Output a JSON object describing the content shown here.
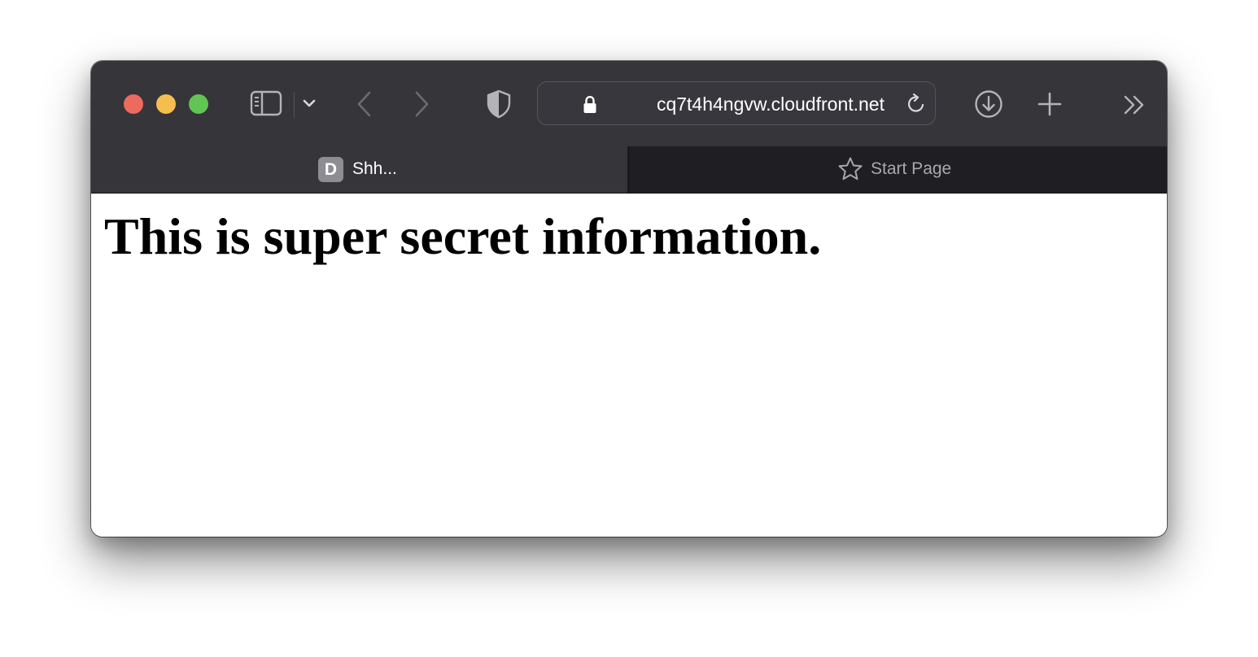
{
  "browser": {
    "window_controls": [
      "close",
      "minimize",
      "zoom"
    ],
    "toolbar": {
      "sidebar_icon": "sidebar-icon",
      "tab_overview_icon": "chevron-down-icon",
      "back_icon": "chevron-left-icon",
      "forward_icon": "chevron-right-icon",
      "privacy_icon": "shield-icon",
      "download_icon": "download-icon",
      "new_tab_icon": "plus-icon",
      "more_icon": "double-chevron-right-icon"
    },
    "address_bar": {
      "lock_icon": "lock-icon",
      "url": "cq7t4h4ngvw.cloudfront.net",
      "reload_icon": "reload-icon"
    },
    "tabs": [
      {
        "favicon_letter": "D",
        "label": "Shh...",
        "active": true
      },
      {
        "icon": "star-icon",
        "label": "Start Page",
        "active": false
      }
    ]
  },
  "page": {
    "heading": "This is super secret information."
  },
  "colors": {
    "toolbar_bg": "#36353a",
    "tabbar_bg": "#1f1e22",
    "close": "#ed6a5e",
    "minimize": "#f5bf4f",
    "zoom": "#61c554"
  }
}
